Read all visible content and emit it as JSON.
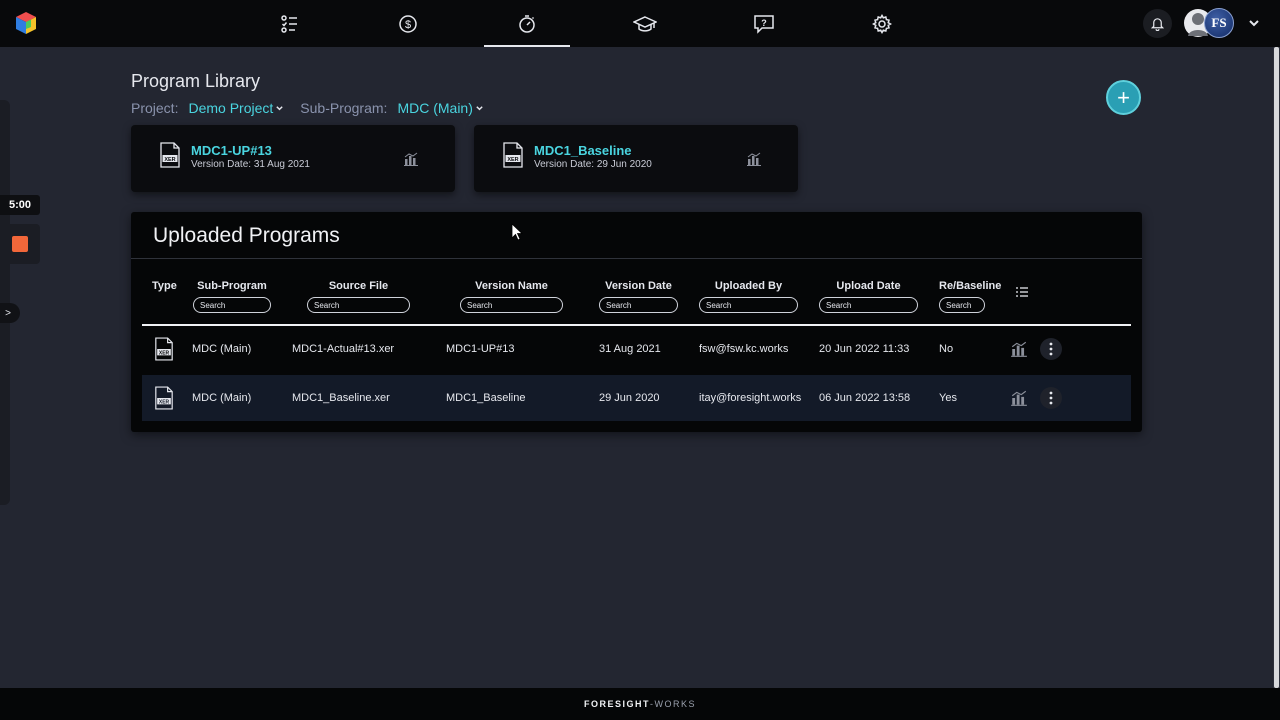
{
  "nav": {
    "icons": [
      "checklist-icon",
      "dollar-icon",
      "stopwatch-icon",
      "graduation-cap-icon",
      "help-chat-icon",
      "gear-icon"
    ],
    "active_index": 2,
    "avatar_initials": "FS"
  },
  "timer": {
    "value": "5:00"
  },
  "left_panel": {
    "expand_label": ">"
  },
  "header": {
    "title": "Program Library",
    "project_label": "Project:",
    "project_value": "Demo Project",
    "subprogram_label": "Sub-Program:",
    "subprogram_value": "MDC (Main)",
    "add_label": "+"
  },
  "cards": [
    {
      "title": "MDC1-UP#13",
      "date": "Version Date: 31 Aug 2021"
    },
    {
      "title": "MDC1_Baseline",
      "date": "Version Date: 29 Jun 2020"
    }
  ],
  "uploaded": {
    "title": "Uploaded Programs",
    "columns": [
      "Type",
      "Sub-Program",
      "Source File",
      "Version Name",
      "Version Date",
      "Uploaded By",
      "Upload Date",
      "Re/Baseline"
    ],
    "search_placeholder": "Search",
    "rows": [
      {
        "subprogram": "MDC (Main)",
        "source": "MDC1-Actual#13.xer",
        "version": "MDC1-UP#13",
        "version_date": "31 Aug 2021",
        "uploaded_by": "fsw@fsw.kc.works",
        "upload_date": "20 Jun 2022 11:33",
        "rebaseline": "No"
      },
      {
        "subprogram": "MDC (Main)",
        "source": "MDC1_Baseline.xer",
        "version": "MDC1_Baseline",
        "version_date": "29 Jun 2020",
        "uploaded_by": "itay@foresight.works",
        "upload_date": "06 Jun 2022 13:58",
        "rebaseline": "Yes"
      }
    ]
  },
  "footer": {
    "brand_bold": "FORESIGHT",
    "brand_light": "-WORKS"
  },
  "colors": {
    "accent": "#4ad5e0",
    "background": "#232631",
    "panel": "#050607",
    "stop": "#f2673a"
  }
}
